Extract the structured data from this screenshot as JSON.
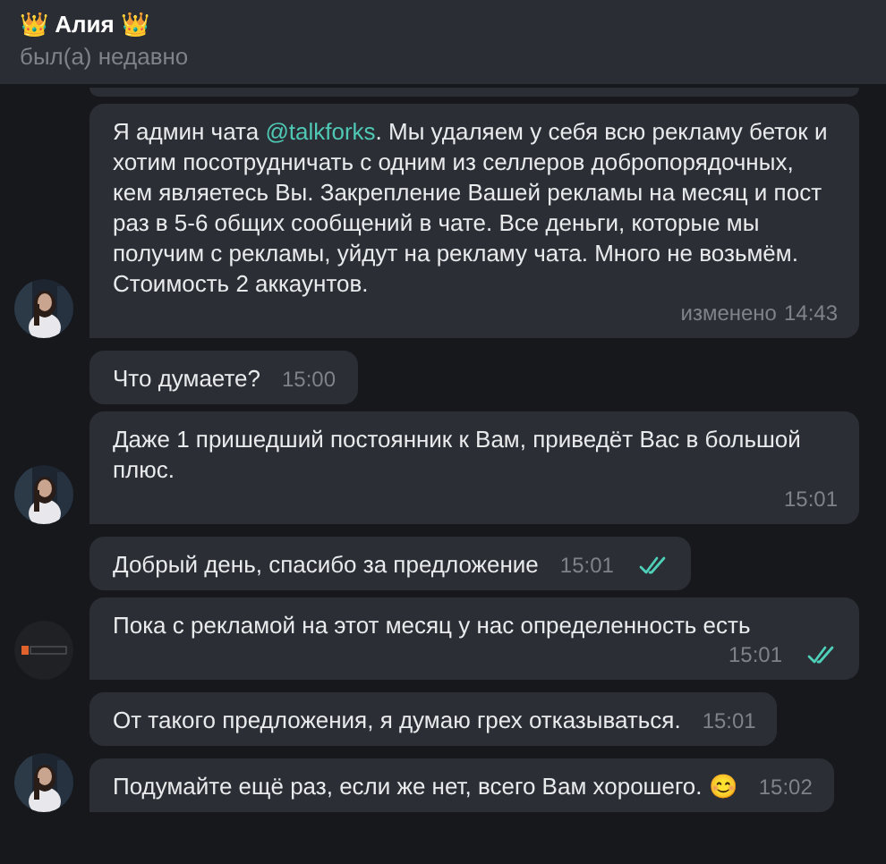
{
  "header": {
    "title": "👑 Алия 👑",
    "status": "был(а) недавно"
  },
  "messages": [
    {
      "parts": [
        {
          "kind": "plain",
          "text": "Я админ чата "
        },
        {
          "kind": "link",
          "text": "@talkforks"
        },
        {
          "kind": "plain",
          "text": ". Мы удаляем у себя всю рекламу беток и хотим посотрудничать с одним из селлеров добропорядочных, кем являетесь Вы. Закрепление Вашей рекламы на месяц и пост раз в 5-6 общих сообщений в чате. Все деньги, которые мы получим с рекламы, уйдут на рекламу чата. Много не возьмём. Стоимость 2 аккаунтов."
        }
      ],
      "edited": "изменено",
      "time": "14:43",
      "read": false
    },
    {
      "parts": [
        {
          "kind": "plain",
          "text": "Что думаете?"
        }
      ],
      "time": "15:00",
      "kind": "plain",
      "read": false
    },
    {
      "parts": [
        {
          "kind": "plain",
          "text": "Даже 1 пришедший постоянник к Вам, приведёт Вас в большой плюс."
        }
      ],
      "time": "15:01",
      "read": false
    },
    {
      "parts": [
        {
          "kind": "plain",
          "text": "Добрый день, спасибо за предложение"
        }
      ],
      "time": "15:01",
      "kind": "plain",
      "read": true
    },
    {
      "parts": [
        {
          "kind": "plain",
          "text": "Пока с рекламой на этот месяц у нас определенность есть"
        }
      ],
      "time": "15:01",
      "kind": "logo",
      "read": true
    },
    {
      "parts": [
        {
          "kind": "plain",
          "text": "От такого предложения, я думаю грех отказываться."
        }
      ],
      "time": "15:01",
      "kind": "plain",
      "read": false
    },
    {
      "parts": [
        {
          "kind": "plain",
          "text": "Подумайте ещё раз, если же нет, всего Вам хорошего. 😊"
        }
      ],
      "time": "15:02",
      "read": false
    }
  ]
}
